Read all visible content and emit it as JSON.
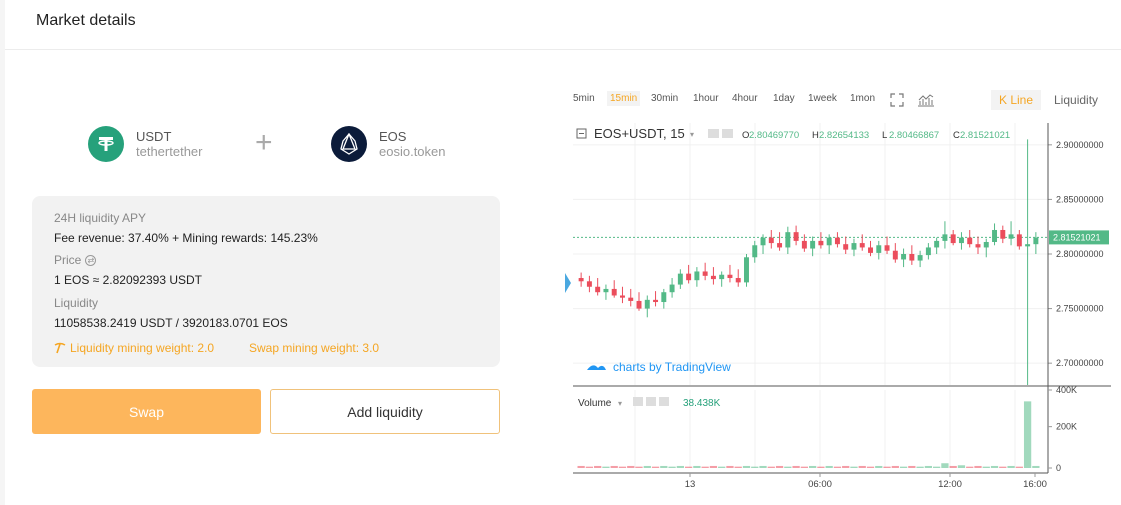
{
  "header": {
    "title": "Market details"
  },
  "pair": {
    "base": {
      "symbol": "USDT",
      "contract": "tethertether",
      "color": "#26a17b"
    },
    "quote": {
      "symbol": "EOS",
      "contract": "eosio.token",
      "color": "#0b1b3a"
    },
    "plus": "+"
  },
  "info": {
    "apy_label": "24H liquidity APY",
    "apy_value": "Fee revenue: 37.40% + Mining rewards: 145.23%",
    "price_label": "Price",
    "price_value": "1 EOS ≈ 2.82092393 USDT",
    "liquidity_label": "Liquidity",
    "liquidity_value": "11058538.2419 USDT / 3920183.0701 EOS",
    "liq_weight": "Liquidity mining weight: 2.0",
    "swap_weight": "Swap mining weight: 3.0"
  },
  "buttons": {
    "swap": "Swap",
    "add_liquidity": "Add liquidity"
  },
  "chart_toolbar": {
    "timeframes": [
      "5min",
      "15min",
      "30min",
      "1hour",
      "4hour",
      "1day",
      "1week",
      "1mon"
    ],
    "active_timeframe": "15min",
    "tabs": {
      "kline": "K Line",
      "liquidity": "Liquidity"
    }
  },
  "chart_data": {
    "type": "candlestick",
    "title": "EOS+USDT, 15",
    "ohlc_legend": {
      "o_label": "O",
      "o": "2.80469770",
      "h_label": "H",
      "h": "2.82654133",
      "l_label": "L",
      "l": "2.80466867",
      "c_label": "C",
      "c": "2.81521021"
    },
    "last_price": "2.81521021",
    "ylim": [
      2.68,
      2.92
    ],
    "yticks": [
      "2.90000000",
      "2.85000000",
      "2.80000000",
      "2.75000000",
      "2.70000000"
    ],
    "xticks": [
      "13",
      "06:00",
      "12:00",
      "16:00"
    ],
    "watermark": "charts by TradingView",
    "volume": {
      "label": "Volume",
      "value": "38.438K",
      "yticks": [
        "400K",
        "200K",
        "0"
      ]
    },
    "up_color": "#53b987",
    "down_color": "#eb4d5c",
    "candles": [
      [
        2.778,
        2.783,
        2.77,
        2.775
      ],
      [
        2.775,
        2.78,
        2.765,
        2.77
      ],
      [
        2.77,
        2.778,
        2.762,
        2.765
      ],
      [
        2.765,
        2.772,
        2.758,
        2.768
      ],
      [
        2.768,
        2.776,
        2.76,
        2.762
      ],
      [
        2.762,
        2.77,
        2.755,
        2.76
      ],
      [
        2.76,
        2.768,
        2.752,
        2.757
      ],
      [
        2.757,
        2.765,
        2.748,
        2.75
      ],
      [
        2.75,
        2.762,
        2.742,
        2.758
      ],
      [
        2.758,
        2.766,
        2.752,
        2.756
      ],
      [
        2.756,
        2.768,
        2.75,
        2.765
      ],
      [
        2.765,
        2.778,
        2.76,
        2.772
      ],
      [
        2.772,
        2.786,
        2.768,
        2.782
      ],
      [
        2.782,
        2.79,
        2.773,
        2.776
      ],
      [
        2.776,
        2.788,
        2.77,
        2.784
      ],
      [
        2.784,
        2.792,
        2.776,
        2.78
      ],
      [
        2.78,
        2.788,
        2.772,
        2.777
      ],
      [
        2.777,
        2.784,
        2.77,
        2.781
      ],
      [
        2.781,
        2.79,
        2.774,
        2.778
      ],
      [
        2.778,
        2.786,
        2.77,
        2.774
      ],
      [
        2.774,
        2.8,
        2.77,
        2.797
      ],
      [
        2.797,
        2.812,
        2.792,
        2.808
      ],
      [
        2.808,
        2.818,
        2.8,
        2.815
      ],
      [
        2.815,
        2.822,
        2.805,
        2.81
      ],
      [
        2.81,
        2.82,
        2.803,
        2.806
      ],
      [
        2.806,
        2.825,
        2.8,
        2.82
      ],
      [
        2.82,
        2.826,
        2.808,
        2.812
      ],
      [
        2.812,
        2.818,
        2.802,
        2.805
      ],
      [
        2.805,
        2.816,
        2.798,
        2.812
      ],
      [
        2.812,
        2.82,
        2.805,
        2.808
      ],
      [
        2.808,
        2.818,
        2.8,
        2.815
      ],
      [
        2.815,
        2.82,
        2.806,
        2.809
      ],
      [
        2.809,
        2.816,
        2.8,
        2.804
      ],
      [
        2.804,
        2.814,
        2.798,
        2.81
      ],
      [
        2.81,
        2.818,
        2.803,
        2.806
      ],
      [
        2.806,
        2.812,
        2.798,
        2.801
      ],
      [
        2.801,
        2.812,
        2.795,
        2.808
      ],
      [
        2.808,
        2.816,
        2.8,
        2.803
      ],
      [
        2.803,
        2.81,
        2.792,
        2.795
      ],
      [
        2.795,
        2.805,
        2.788,
        2.8
      ],
      [
        2.8,
        2.808,
        2.79,
        2.794
      ],
      [
        2.794,
        2.803,
        2.788,
        2.799
      ],
      [
        2.799,
        2.81,
        2.795,
        2.806
      ],
      [
        2.806,
        2.815,
        2.8,
        2.812
      ],
      [
        2.812,
        2.83,
        2.805,
        2.818
      ],
      [
        2.818,
        2.822,
        2.808,
        2.81
      ],
      [
        2.81,
        2.82,
        2.804,
        2.815
      ],
      [
        2.815,
        2.822,
        2.806,
        2.809
      ],
      [
        2.809,
        2.816,
        2.8,
        2.806
      ],
      [
        2.806,
        2.814,
        2.797,
        2.811
      ],
      [
        2.811,
        2.828,
        2.808,
        2.822
      ],
      [
        2.822,
        2.826,
        2.81,
        2.814
      ],
      [
        2.814,
        2.83,
        2.808,
        2.818
      ],
      [
        2.818,
        2.822,
        2.804,
        2.807
      ],
      [
        2.807,
        2.905,
        2.68,
        2.809
      ],
      [
        2.809,
        2.82,
        2.8,
        2.815
      ]
    ],
    "volumes": [
      0.03,
      0.02,
      0.03,
      0.02,
      0.03,
      0.02,
      0.03,
      0.02,
      0.03,
      0.02,
      0.03,
      0.02,
      0.03,
      0.02,
      0.03,
      0.02,
      0.03,
      0.02,
      0.03,
      0.02,
      0.03,
      0.02,
      0.03,
      0.02,
      0.03,
      0.02,
      0.03,
      0.02,
      0.03,
      0.02,
      0.03,
      0.02,
      0.03,
      0.02,
      0.03,
      0.02,
      0.03,
      0.02,
      0.03,
      0.02,
      0.03,
      0.02,
      0.03,
      0.02,
      0.07,
      0.03,
      0.04,
      0.02,
      0.03,
      0.02,
      0.03,
      0.02,
      0.03,
      0.02,
      0.98,
      0.03
    ]
  }
}
